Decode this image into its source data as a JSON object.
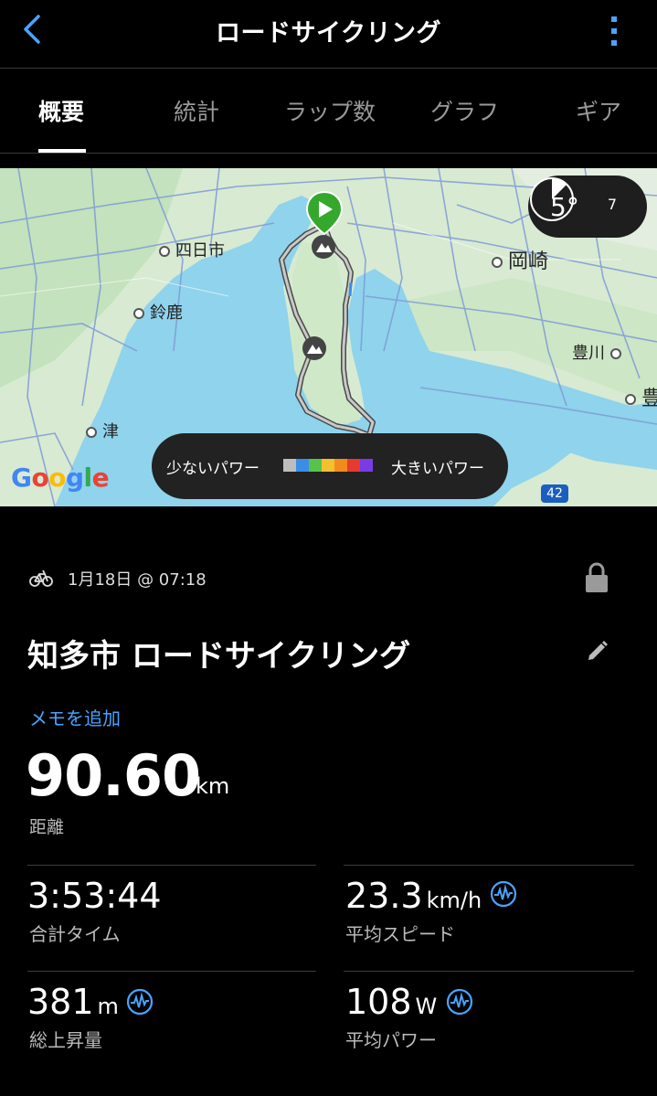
{
  "header": {
    "title": "ロードサイクリング"
  },
  "tabs": [
    {
      "label": "概要",
      "active": true
    },
    {
      "label": "統計"
    },
    {
      "label": "ラップ数"
    },
    {
      "label": "グラフ"
    },
    {
      "label": "ギア"
    }
  ],
  "map": {
    "cities": [
      "四日市",
      "鈴鹿",
      "津",
      "岡崎",
      "豊川",
      "豊"
    ],
    "weather": {
      "temp": "5°",
      "count": "7"
    },
    "legend": {
      "low": "少ないパワー",
      "high": "大きいパワー",
      "colors": [
        "#bdbdbd",
        "#3b8ee8",
        "#58c34a",
        "#f2c12e",
        "#f28a1e",
        "#e63b2e",
        "#7a3be6"
      ]
    },
    "route_badge": "42",
    "attribution": "Google"
  },
  "activity": {
    "date": "1月18日 @ 07:18",
    "name": "知多市 ロードサイクリング",
    "memo_link": "メモを追加"
  },
  "distance": {
    "value": "90.60",
    "unit": "km",
    "label": "距離"
  },
  "stats": [
    {
      "value": "3:53:44",
      "unit": "",
      "label": "合計タイム",
      "icon": ""
    },
    {
      "value": "23.3",
      "unit": "km/h",
      "label": "平均スピード",
      "icon": "activity-wave-icon"
    },
    {
      "value": "381",
      "unit": "m",
      "label": "総上昇量",
      "icon": "activity-wave-icon"
    },
    {
      "value": "108",
      "unit": "W",
      "label": "平均パワー",
      "icon": "activity-wave-icon"
    }
  ],
  "colors": {
    "accent": "#4aa3ff",
    "background": "#000000",
    "start_marker": "#34a82c"
  }
}
